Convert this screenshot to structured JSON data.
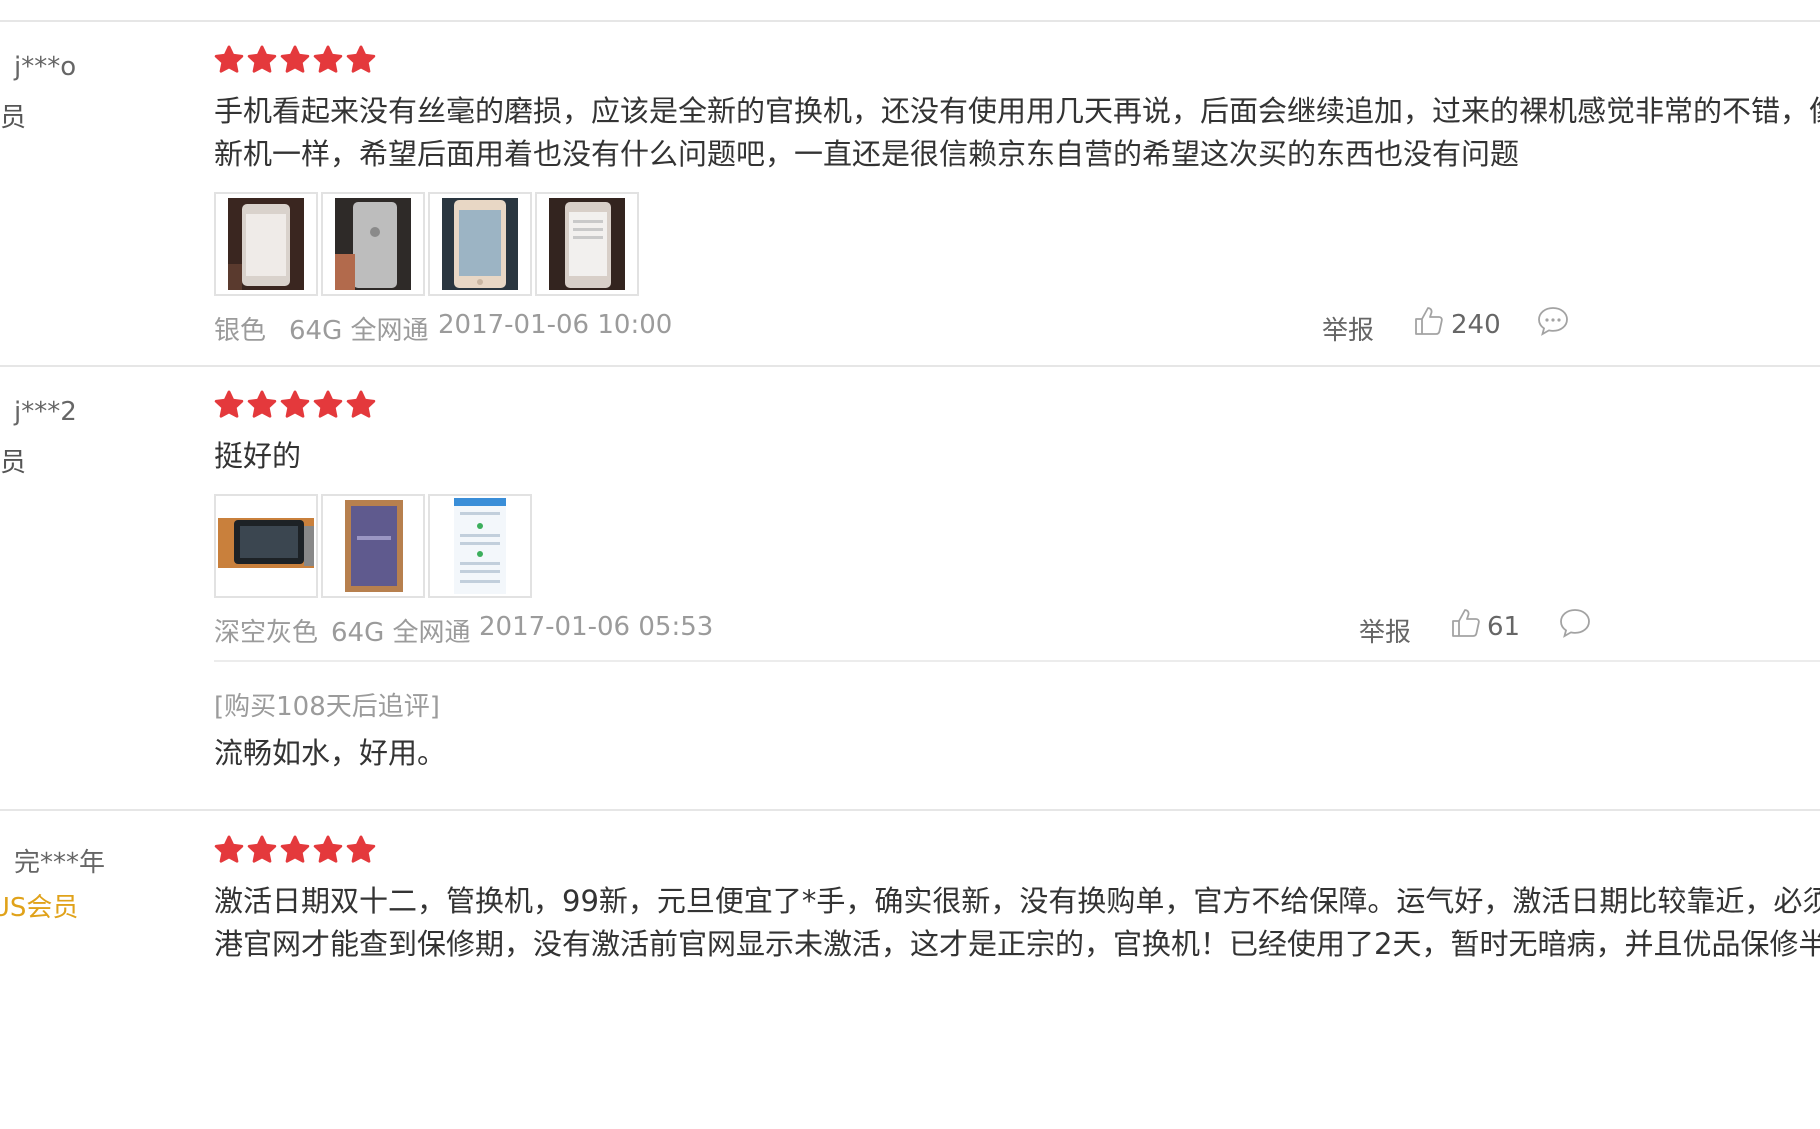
{
  "reviews": [
    {
      "user": "j***o",
      "level": "会员",
      "rating": 5,
      "content_line1": "手机看起来没有丝毫的磨损，应该是全新的官换机，还没有使用用几天再说，后面会继续追加，过来的裸机感觉非常的不错，像全",
      "content_line2": "新机一样，希望后面用着也没有什么问题吧，一直还是很信赖京东自营的希望这次买的东西也没有问题",
      "color": "银色",
      "spec": "64G 全网通",
      "time": "2017-01-06 10:00",
      "report": "举报",
      "likes": "240"
    },
    {
      "user": "j***2",
      "level": "会员",
      "rating": 5,
      "content_line1": "挺好的",
      "color": "深空灰色",
      "spec": "64G 全网通",
      "time": "2017-01-06 05:53",
      "report": "举报",
      "likes": "61",
      "append_label": "[购买108天后追评]",
      "append_text": "流畅如水，好用。"
    },
    {
      "user": "完***年",
      "level": "PLUS会员",
      "rating": 5,
      "content_line1": "激活日期双十二，管换机，99新，元旦便宜了*手，确实很新，没有换购单，官方不给保障。运气好，激活日期比较靠近，必须从香",
      "content_line2": "港官网才能查到保修期，没有激活前官网显示未激活，这才是正宗的，官换机！已经使用了2天，暂时无暗病，并且优品保修半年"
    }
  ],
  "colors": {
    "star": "#e4393c",
    "meta": "#9b9b9b",
    "plus": "#e0a21a",
    "divider": "#e6e6e6"
  },
  "icons": {
    "star": "star-icon",
    "like": "thumbs-up-icon",
    "reply": "comment-bubble-icon"
  }
}
